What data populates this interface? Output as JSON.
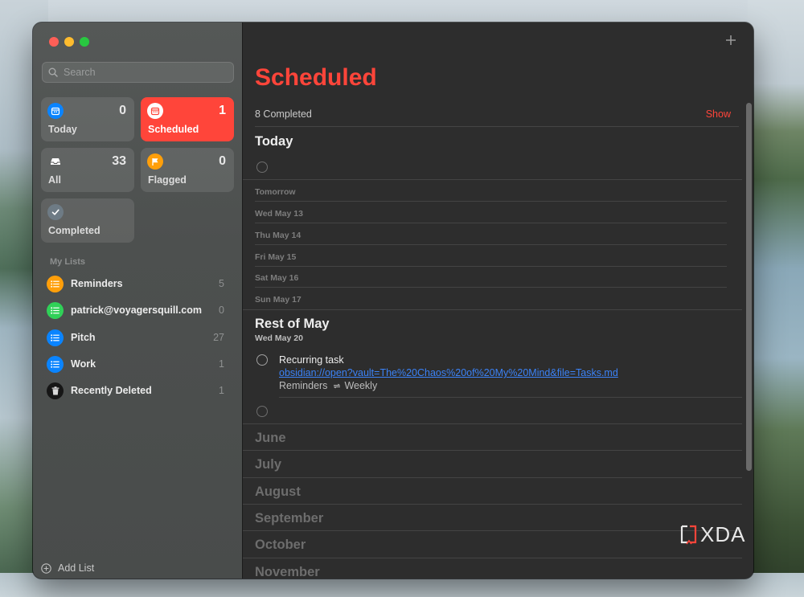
{
  "sidebar": {
    "search_placeholder": "Search",
    "smart_lists": [
      {
        "label": "Today",
        "count": "0",
        "icon": "calendar-icon",
        "color": "#0a84ff"
      },
      {
        "label": "Scheduled",
        "count": "1",
        "icon": "calendar-icon",
        "color": "#ff453a"
      },
      {
        "label": "All",
        "count": "33",
        "icon": "tray-icon",
        "color": "#5a5a5a"
      },
      {
        "label": "Flagged",
        "count": "0",
        "icon": "flag-icon",
        "color": "#ff9f0a"
      },
      {
        "label": "Completed",
        "count": "",
        "icon": "checkmark-icon",
        "color": "#6e7b85"
      }
    ],
    "my_lists_header": "My Lists",
    "lists": [
      {
        "name": "Reminders",
        "count": "5",
        "color": "#ff9f0a",
        "icon": "list-bullet-icon"
      },
      {
        "name": "patrick@voyagersquill.com",
        "count": "0",
        "color": "#30d158",
        "icon": "list-bullet-icon"
      },
      {
        "name": "Pitch",
        "count": "27",
        "color": "#0a84ff",
        "icon": "list-bullet-icon"
      },
      {
        "name": "Work",
        "count": "1",
        "color": "#0a84ff",
        "icon": "list-bullet-icon"
      },
      {
        "name": "Recently Deleted",
        "count": "1",
        "color": "#1c1c1c",
        "icon": "trash-icon"
      }
    ],
    "add_list_label": "Add List"
  },
  "main": {
    "title": "Scheduled",
    "completed_text": "8 Completed",
    "show_label": "Show",
    "today_header": "Today",
    "days": [
      "Tomorrow",
      "Wed May 13",
      "Thu May 14",
      "Fri May 15",
      "Sat May 16",
      "Sun May 17"
    ],
    "rest_of_month_header": "Rest of May",
    "rest_date": "Wed May 20",
    "task": {
      "title": "Recurring task",
      "link": "obsidian://open?vault=The%20Chaos%20of%20My%20Mind&file=Tasks.md",
      "list": "Reminders",
      "repeat": "Weekly"
    },
    "months": [
      "June",
      "July",
      "August",
      "September",
      "October",
      "November"
    ]
  },
  "watermark": "XDA",
  "colors": {
    "accent": "#ff453a",
    "link": "#3b82f6"
  }
}
